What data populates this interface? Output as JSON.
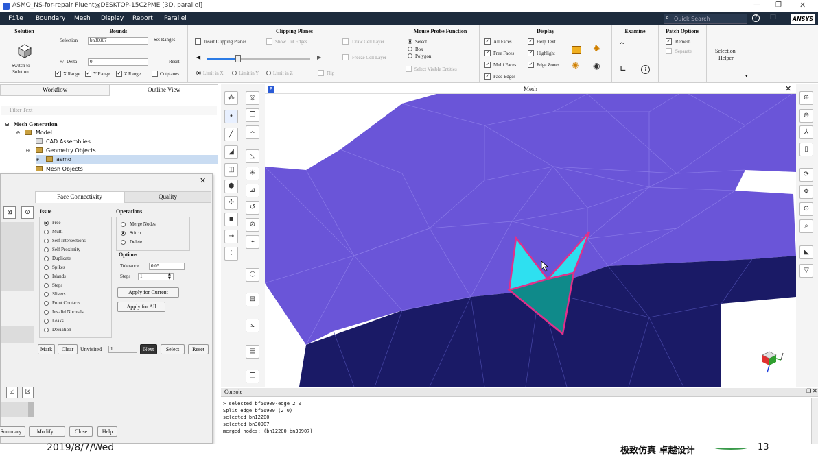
{
  "window": {
    "title": "ASMO_NS-for-repair Fluent@DESKTOP-15C2PME  [3D, parallel]"
  },
  "menu": [
    "File",
    "Boundary",
    "Mesh",
    "Display",
    "Report",
    "Parallel"
  ],
  "search": {
    "placeholder": "Quick Search"
  },
  "brand": "ANSYS",
  "ribbon": {
    "solution": {
      "title": "Solution",
      "switch_label_1": "Switch to",
      "switch_label_2": "Solution"
    },
    "bounds": {
      "title": "Bounds",
      "selection_label": "Selection",
      "selection_value": "bn30907",
      "set_ranges": "Set Ranges",
      "delta_label": "+/- Delta",
      "delta_value": "0",
      "reset": "Reset",
      "x_range": "X Range",
      "y_range": "Y Range",
      "z_range": "Z Range",
      "cutplanes": "Cutplanes"
    },
    "clipping": {
      "title": "Clipping Planes",
      "insert": "Insert Clipping Planes",
      "show_cut": "Show Cut Edges",
      "draw_cell": "Draw Cell Layer",
      "freeze_cell": "Freeze Cell Layer",
      "limit_x": "Limit in X",
      "limit_y": "Limit in Y",
      "limit_z": "Limit in Z",
      "flip": "Flip",
      "slider_value": 0.3
    },
    "probe": {
      "title": "Mouse Probe Function",
      "select": "Select",
      "box": "Box",
      "polygon": "Polygon",
      "select_visible": "Select Visible Entities"
    },
    "display": {
      "title": "Display",
      "all_faces": "All Faces",
      "free_faces": "Free Faces",
      "multi_faces": "Multi Faces",
      "face_edges": "Face Edges",
      "help_text": "Help Text",
      "highlight": "Highlight",
      "edge_zones": "Edge Zones"
    },
    "examine": {
      "title": "Examine"
    },
    "patch": {
      "title": "Patch Options",
      "remesh": "Remesh",
      "separate": "Separate"
    },
    "selection_helper": {
      "line1": "Selection",
      "line2": "Helper"
    }
  },
  "left_tabs": {
    "workflow": "Workflow",
    "outline": "Outline View"
  },
  "filter": {
    "placeholder": "Filter Text"
  },
  "tree": {
    "root": "Mesh Generation",
    "model": "Model",
    "cad": "CAD Assemblies",
    "geom": "Geometry Objects",
    "asmo": "asmo",
    "mesh_objects": "Mesh Objects"
  },
  "dialog": {
    "tab_face": "Face Connectivity",
    "tab_quality": "Quality",
    "issue_title": "Issue",
    "issues": [
      "Free",
      "Multi",
      "Self Intersections",
      "Self Proximity",
      "Duplicate",
      "Spikes",
      "Islands",
      "Steps",
      "Slivers",
      "Point Contacts",
      "Invalid Normals",
      "Leaks",
      "Deviation"
    ],
    "operations_title": "Operations",
    "operations": [
      "Merge Nodes",
      "Stitch",
      "Delete"
    ],
    "options_title": "Options",
    "tolerance_label": "Tolerance",
    "tolerance_value": "0.05",
    "steps_label": "Steps",
    "steps_value": "1",
    "apply_current": "Apply for Current",
    "apply_all": "Apply for All",
    "mark": "Mark",
    "clear": "Clear",
    "unvisited_label": "Unvisited",
    "unvisited_value": "1",
    "next": "Next",
    "select": "Select",
    "reset": "Reset",
    "summary": "Summary",
    "modify": "Modify...",
    "close": "Close",
    "help": "Help"
  },
  "viewport": {
    "title": "Mesh"
  },
  "console": {
    "title": "Console",
    "lines": [
      "> selected bf56909-edge 2 0",
      "Split edge bf56909 (2 0)",
      "selected bn12200",
      "selected bn30907",
      "merged nodes: (bn12200 bn30907)"
    ]
  },
  "footer": {
    "date": "2019/8/7/Wed",
    "slogan": "极致仿真 卓越设计",
    "page": "13"
  },
  "colors": {
    "menubar": "#1d2b3d",
    "mesh_light": "#6a55d8",
    "mesh_dark": "#1a1a66",
    "highlight": "#e0308a",
    "cyan": "#2ee0f0",
    "teal": "#0f8a8a"
  }
}
